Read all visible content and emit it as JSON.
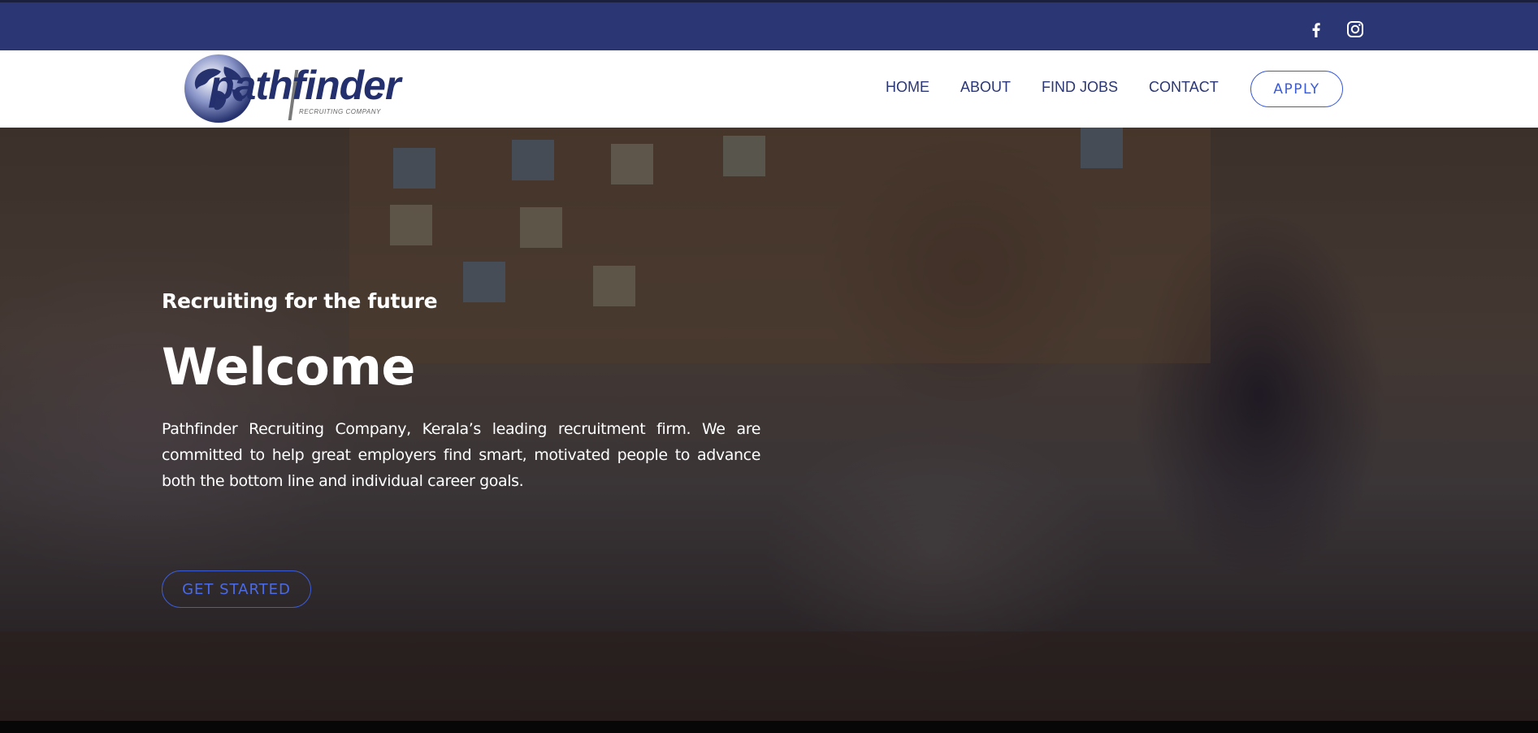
{
  "topbar": {
    "background": "#2b3675",
    "social": [
      {
        "icon": "facebook-icon"
      },
      {
        "icon": "instagram-icon"
      }
    ]
  },
  "header": {
    "logo": {
      "brand": "pathfinder",
      "tagline": "RECRUITING COMPANY"
    },
    "nav": [
      {
        "label": "HOME"
      },
      {
        "label": "ABOUT"
      },
      {
        "label": "FIND JOBS"
      },
      {
        "label": "CONTACT"
      }
    ],
    "apply_label": "APPLY"
  },
  "hero": {
    "eyebrow": "Recruiting for the future",
    "title": "Welcome",
    "description": "Pathfinder Recruiting Company, Kerala’s leading recruitment firm. We are committed to help great employers find smart, motivated people to advance both the bottom line and individual career goals.",
    "cta_label": "GET STARTED"
  },
  "colors": {
    "brand_navy": "#2b3675",
    "accent_blue": "#3b5bd6",
    "white": "#ffffff"
  }
}
